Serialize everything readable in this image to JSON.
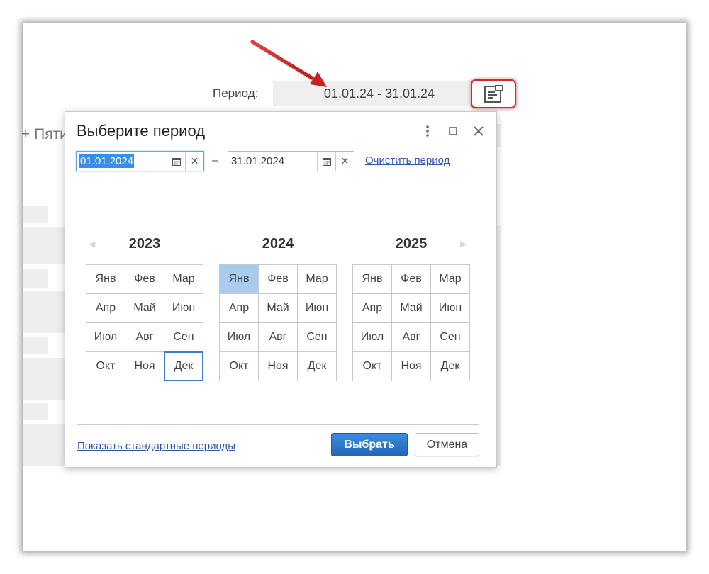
{
  "form": {
    "period_label": "Период:",
    "period_value": "01.01.24 - 31.01.24",
    "bg_text": "+ Пяти"
  },
  "dialog": {
    "title": "Выберите период",
    "start_date": "01.01.2024",
    "dash": "–",
    "end_date": "31.01.2024",
    "clear_label": "Очистить период",
    "years": [
      {
        "year": "2023",
        "months": [
          "Янв",
          "Фев",
          "Мар",
          "Апр",
          "Май",
          "Июн",
          "Июл",
          "Авг",
          "Сен",
          "Окт",
          "Ноя",
          "Дек"
        ]
      },
      {
        "year": "2024",
        "months": [
          "Янв",
          "Фев",
          "Мар",
          "Апр",
          "Май",
          "Июн",
          "Июл",
          "Авг",
          "Сен",
          "Окт",
          "Ноя",
          "Дек"
        ]
      },
      {
        "year": "2025",
        "months": [
          "Янв",
          "Фев",
          "Мар",
          "Апр",
          "Май",
          "Июн",
          "Июл",
          "Авг",
          "Сен",
          "Окт",
          "Ноя",
          "Дек"
        ]
      }
    ],
    "selected_month": "2024-Янв",
    "focused_month": "2023-Дек",
    "show_standard_label": "Показать стандартные периоды",
    "ok_label": "Выбрать",
    "cancel_label": "Отмена"
  },
  "colors": {
    "accent": "#2f7ad1",
    "selected_month_bg": "#a9cbee",
    "highlight_red": "#d12b2b",
    "link": "#3458a8"
  },
  "icons": [
    "calendar-icon",
    "clear-icon",
    "more-vert-icon",
    "maximize-icon",
    "close-icon",
    "period-select-icon",
    "arrow-left-icon",
    "arrow-right-icon",
    "red-pointer-arrow"
  ]
}
